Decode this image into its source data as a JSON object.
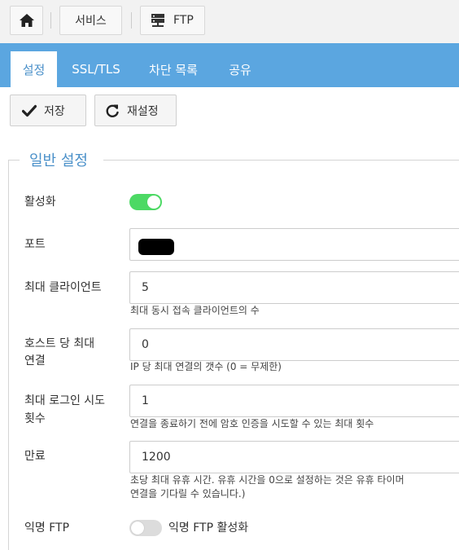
{
  "breadcrumb": {
    "home_icon": "home-icon",
    "items": [
      {
        "label": "서비스"
      },
      {
        "label": "FTP",
        "icon": "server-icon"
      }
    ]
  },
  "tabs": [
    {
      "label": "설정",
      "active": true
    },
    {
      "label": "SSL/TLS",
      "active": false
    },
    {
      "label": "차단 목록",
      "active": false
    },
    {
      "label": "공유",
      "active": false
    }
  ],
  "toolbar": {
    "save_label": "저장",
    "save_icon": "checkmark-icon",
    "reset_label": "재설정",
    "reset_icon": "refresh-icon"
  },
  "section": {
    "legend": "일반 설정",
    "fields": {
      "enable": {
        "label": "활성화",
        "value": true
      },
      "port": {
        "label": "포트",
        "value": "",
        "redacted": true
      },
      "max_clients": {
        "label": "최대 클라이언트",
        "value": "5",
        "help": "최대 동시 접속 클라이언트의 수"
      },
      "max_per_host": {
        "label_line1": "호스트 당 최대",
        "label_line2": "연결",
        "value": "0",
        "help": "IP 당 최대 연결의 갯수 (0 = 무제한)"
      },
      "max_login": {
        "label_line1": "최대 로그인 시도",
        "label_line2": "횟수",
        "value": "1",
        "help": "연결을 종료하기 전에 암호 인증을 시도할 수 있는 최대 횟수"
      },
      "timeout": {
        "label": "만료",
        "value": "1200",
        "help_line1": "초당 최대 유휴 시간. 유휴 시간을 0으로 설정하는 것은 유휴 타이머",
        "help_line2": "연결을 기다릴 수 있습니다.)"
      },
      "anonymous": {
        "label": "익명 FTP",
        "value": false,
        "toggle_label": "익명 FTP 활성화"
      }
    }
  },
  "colors": {
    "tab_bar": "#5ba6e0",
    "accent": "#4a90c9",
    "toggle_on": "#4cd964",
    "toggle_off": "#dcdcdc"
  }
}
